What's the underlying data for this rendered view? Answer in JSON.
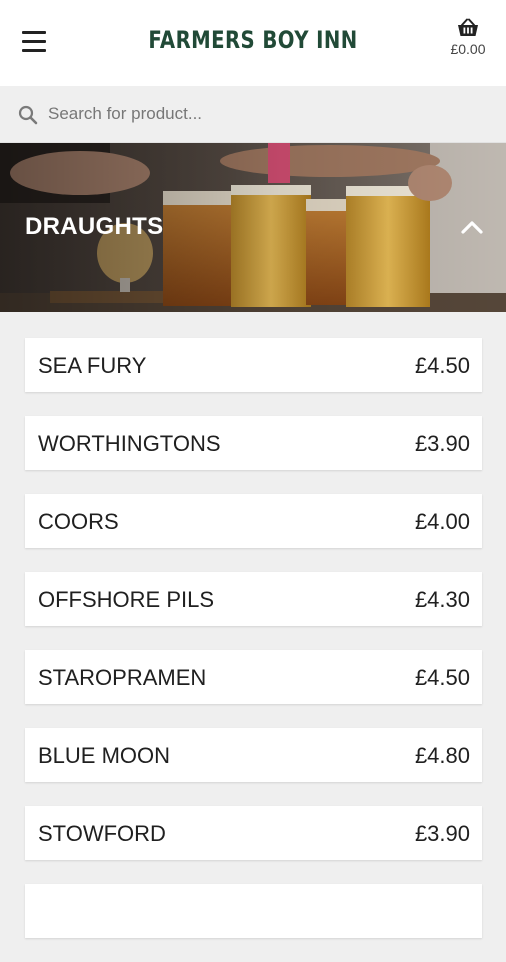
{
  "header": {
    "title": "FARMERS BOY INN",
    "cart_total": "£0.00"
  },
  "search": {
    "placeholder": "Search for product..."
  },
  "category": {
    "title": "DRAUGHTS",
    "expanded": true
  },
  "products": [
    {
      "name": "SEA FURY",
      "price": "£4.50"
    },
    {
      "name": "WORTHINGTONS",
      "price": "£3.90"
    },
    {
      "name": "COORS",
      "price": "£4.00"
    },
    {
      "name": "OFFSHORE PILS",
      "price": "£4.30"
    },
    {
      "name": "STAROPRAMEN",
      "price": "£4.50"
    },
    {
      "name": "BLUE MOON",
      "price": "£4.80"
    },
    {
      "name": "STOWFORD",
      "price": "£3.90"
    },
    {
      "name": "",
      "price": ""
    }
  ],
  "colors": {
    "brand": "#214a37",
    "background": "#efefef"
  }
}
